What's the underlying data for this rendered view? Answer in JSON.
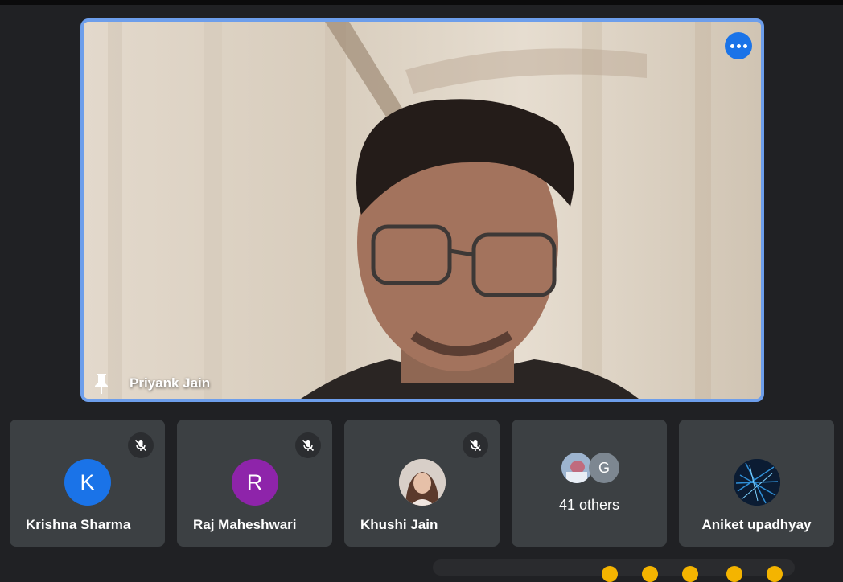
{
  "main": {
    "presenter_name": "Priyank Jain",
    "pin_icon": "pin-icon",
    "more_options_icon": "more-horizontal-icon",
    "accent": "#6d9eeb"
  },
  "participants": [
    {
      "name": "Krishna Sharma",
      "initial": "K",
      "avatar_color": "#1a73e8",
      "muted": true
    },
    {
      "name": "Raj Maheshwari",
      "initial": "R",
      "avatar_color": "#8e24aa",
      "muted": true
    },
    {
      "name": "Khushi Jain",
      "initial": "",
      "avatar_color": "#c9b9ae",
      "muted": true
    },
    {
      "others_label": "41 others",
      "extra_initial": "G"
    },
    {
      "name": "Aniket upadhyay",
      "initial": "",
      "avatar_color": "#0d2742",
      "muted": false
    }
  ]
}
